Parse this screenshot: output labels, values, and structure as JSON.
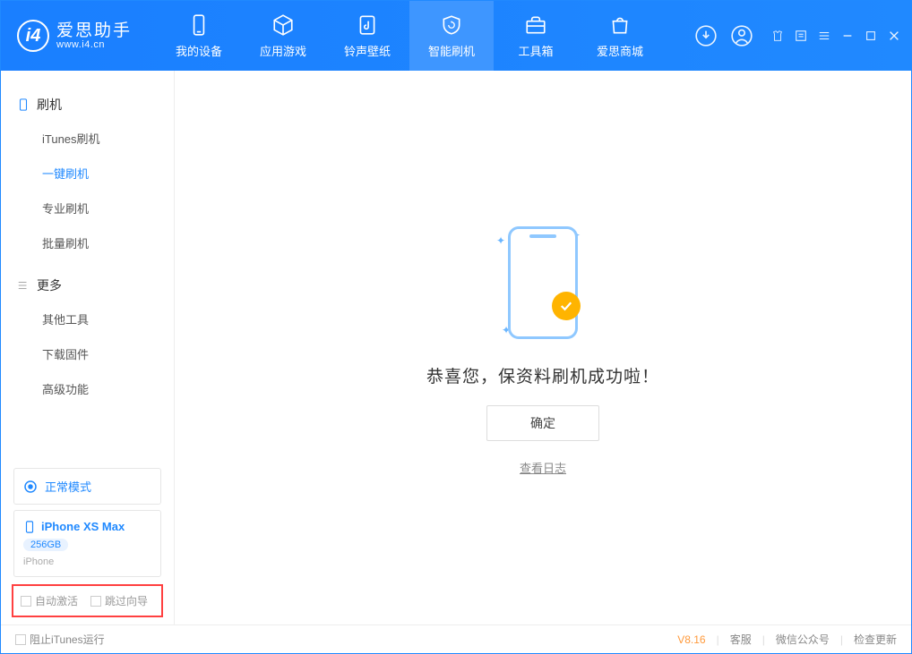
{
  "app": {
    "name": "爱思助手",
    "url": "www.i4.cn"
  },
  "tabs": {
    "device": "我的设备",
    "apps": "应用游戏",
    "ringtone": "铃声壁纸",
    "flash": "智能刷机",
    "toolbox": "工具箱",
    "store": "爱思商城"
  },
  "sidebar": {
    "section_flash": "刷机",
    "items_flash": {
      "itunes": "iTunes刷机",
      "oneclick": "一键刷机",
      "pro": "专业刷机",
      "batch": "批量刷机"
    },
    "section_more": "更多",
    "items_more": {
      "other": "其他工具",
      "firmware": "下载固件",
      "advanced": "高级功能"
    }
  },
  "mode": {
    "label": "正常模式"
  },
  "device": {
    "name": "iPhone XS Max",
    "capacity": "256GB",
    "type": "iPhone"
  },
  "options": {
    "auto_activate": "自动激活",
    "skip_guide": "跳过向导"
  },
  "main": {
    "success": "恭喜您，保资料刷机成功啦！",
    "ok": "确定",
    "view_log": "查看日志"
  },
  "footer": {
    "block_itunes": "阻止iTunes运行",
    "version": "V8.16",
    "support": "客服",
    "wechat": "微信公众号",
    "update": "检查更新"
  }
}
